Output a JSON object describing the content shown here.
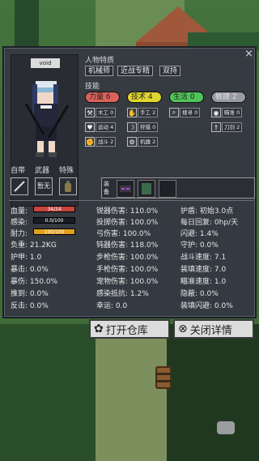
{
  "panel": {
    "close_glyph": "×",
    "character_name": "void",
    "traits_title": "人物特质",
    "traits": [
      "机械师",
      "近战专精",
      "双持"
    ],
    "skills_title": "技能",
    "skill_groups": [
      {
        "label": "力量 6",
        "color": "#d9625a"
      },
      {
        "label": "技术 4",
        "color": "#e0d52d"
      },
      {
        "label": "生活 0",
        "color": "#50c45a"
      },
      {
        "label": "敏捷 2",
        "color": "#9a9aa4"
      }
    ],
    "skill_items": [
      {
        "name": "木工 0",
        "icon": "hammer-icon"
      },
      {
        "name": "手工 2",
        "icon": "hand-tool-icon"
      },
      {
        "name": "搜寻 0",
        "icon": "search-icon"
      },
      {
        "name": "瞄准 0",
        "icon": "eye-icon"
      },
      {
        "name": "运动 4",
        "icon": "heart-icon"
      },
      {
        "name": "狩猎 0",
        "icon": "bow-icon"
      },
      {
        "name": "刀剑 2",
        "icon": "sword-icon"
      },
      {
        "name": "战斗 2",
        "icon": "fight-icon"
      },
      {
        "name": "机器 2",
        "icon": "gear-icon"
      }
    ],
    "equip_labels": {
      "self": "自带",
      "weapon": "武器",
      "special": "特殊",
      "armor": "装备"
    },
    "weapon_text": "暂无",
    "stats_left": {
      "hp_label": "血量:",
      "hp_text": "34/34",
      "hp_fraction": 1.0,
      "infect_label": "感染:",
      "infect_text": "0.0/100",
      "infect_fraction": 0.0,
      "stamina_label": "耐力:",
      "stamina_text": "100/100",
      "stamina_fraction": 1.0,
      "load": "负重:  21.2KG",
      "armor": "护甲:  1.0",
      "crit": "暴击:  0.0%",
      "critdmg": "暴伤:  150.0%",
      "knockback": "推到:  0.0%",
      "counter": "反击:  0.0%"
    },
    "stats_mid": [
      "锐器伤害: 110.0%",
      "投掷伤害: 100.0%",
      "弓伤害: 100.0%",
      "钝器伤害: 118.0%",
      "步枪伤害: 100.0%",
      "手枪伤害: 100.0%",
      "宠物伤害: 100.0%",
      "感染抵抗: 1.2%",
      "幸运: 0.0"
    ],
    "stats_right": [
      "护盾: 初始3.0点",
      "每日回复: 0hp/天",
      "闪避: 1.4%",
      "守护: 0.0%",
      "战斗速度: 7.1",
      "装填速度: 7.0",
      "瞄准速度: 1.0",
      "隐蔽: 0.0%",
      "装填闪避: 0.0%"
    ]
  },
  "buttons": {
    "open_storage": "打开仓库",
    "close_details": "关闭详情",
    "open_storage_icon": "storage-icon",
    "close_details_icon": "close-circle-icon"
  },
  "colors": {
    "hp": "#c8443c",
    "stamina": "#e0a020",
    "infect": "#555"
  }
}
